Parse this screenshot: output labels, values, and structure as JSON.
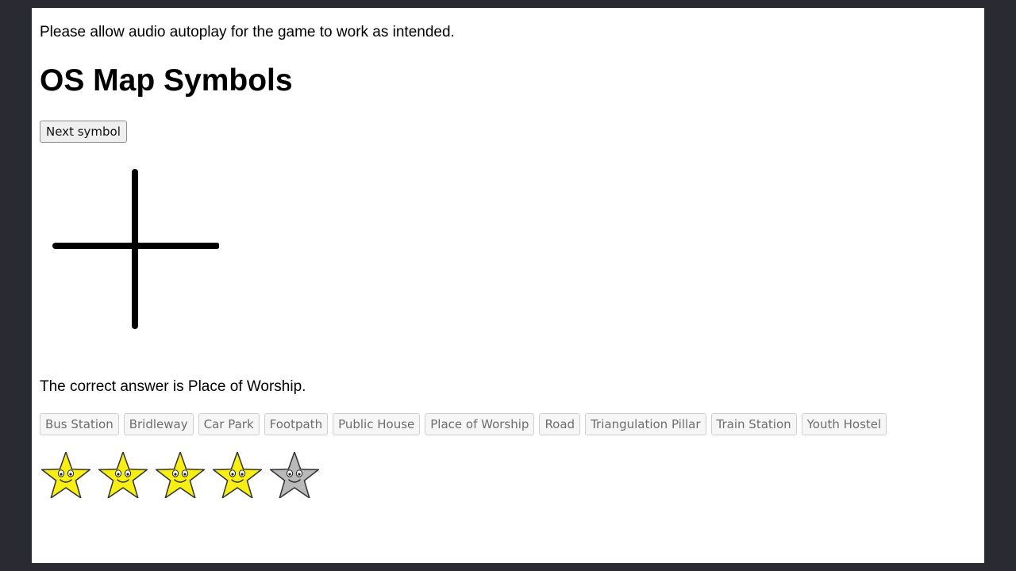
{
  "notice": "Please allow audio autoplay for the game to work as intended.",
  "title": "OS Map Symbols",
  "next_button_label": "Next symbol",
  "current_symbol_icon": "cross-symbol-icon",
  "answer_text": "The correct answer is Place of Worship.",
  "options": [
    {
      "label": "Bus Station"
    },
    {
      "label": "Bridleway"
    },
    {
      "label": "Car Park"
    },
    {
      "label": "Footpath"
    },
    {
      "label": "Public House"
    },
    {
      "label": "Place of Worship"
    },
    {
      "label": "Road"
    },
    {
      "label": "Triangulation Pillar"
    },
    {
      "label": "Train Station"
    },
    {
      "label": "Youth Hostel"
    }
  ],
  "stars": [
    {
      "state": "earned",
      "color": "#f7ef13"
    },
    {
      "state": "earned",
      "color": "#f7ef13"
    },
    {
      "state": "earned",
      "color": "#f7ef13"
    },
    {
      "state": "earned",
      "color": "#f7ef13"
    },
    {
      "state": "empty",
      "color": "#b9b9b9"
    }
  ],
  "colors": {
    "background": "#2a2a32",
    "page": "#ffffff",
    "star_earned": "#f7ef13",
    "star_empty": "#b9b9b9"
  }
}
